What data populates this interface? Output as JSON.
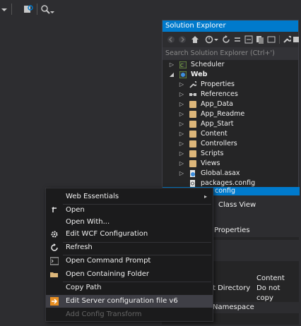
{
  "solution_explorer": {
    "title": "Solution Explorer",
    "search_placeholder": "Search Solution Explorer (Ctrl+')",
    "items": [
      {
        "label": "Scheduler",
        "icon": "csharp-project-icon"
      },
      {
        "label": "Web",
        "icon": "web-project-icon"
      },
      {
        "label": "Properties",
        "icon": "wrench-icon"
      },
      {
        "label": "References",
        "icon": "references-icon"
      },
      {
        "label": "App_Data",
        "icon": "folder-icon"
      },
      {
        "label": "App_Readme",
        "icon": "folder-icon"
      },
      {
        "label": "App_Start",
        "icon": "folder-icon"
      },
      {
        "label": "Content",
        "icon": "folder-icon"
      },
      {
        "label": "Controllers",
        "icon": "folder-icon"
      },
      {
        "label": "Scripts",
        "icon": "folder-icon"
      },
      {
        "label": "Views",
        "icon": "folder-icon"
      },
      {
        "label": "Global.asax",
        "icon": "global-asax-icon"
      },
      {
        "label": "packages.config",
        "icon": "config-file-icon"
      },
      {
        "label": "config",
        "icon": "config-file-icon"
      }
    ]
  },
  "tabs": {
    "class_view": "Class View"
  },
  "properties": {
    "title": "Properties",
    "rows": [
      {
        "name": "",
        "value": "Content"
      },
      {
        "name": "t Directory",
        "value": "Do not copy"
      },
      {
        "name": "Namespace",
        "value": ""
      }
    ]
  },
  "context_menu": {
    "items": [
      {
        "label": "Web Essentials",
        "submenu": true
      },
      {
        "label": "Open",
        "icon": "open-arrow-icon"
      },
      {
        "label": "Open With...",
        "icon": ""
      },
      {
        "label": "Edit WCF Configuration",
        "icon": "wcf-gear-icon"
      },
      {
        "label": "Refresh",
        "icon": "refresh-icon"
      },
      {
        "label": "Open Command Prompt",
        "icon": "command-prompt-icon"
      },
      {
        "label": "Open Containing Folder",
        "icon": "folder-open-icon"
      },
      {
        "label": "Copy Path",
        "icon": ""
      },
      {
        "label": "Edit Server configuration file v6",
        "icon": "server-config-icon"
      },
      {
        "label": "Add Config Transform",
        "icon": "",
        "disabled": true
      }
    ]
  },
  "colors": {
    "accent": "#007acc",
    "background": "#2d2d30",
    "panel": "#252526",
    "menu": "#1b1b1c",
    "highlight_icon": "#e88f22"
  }
}
